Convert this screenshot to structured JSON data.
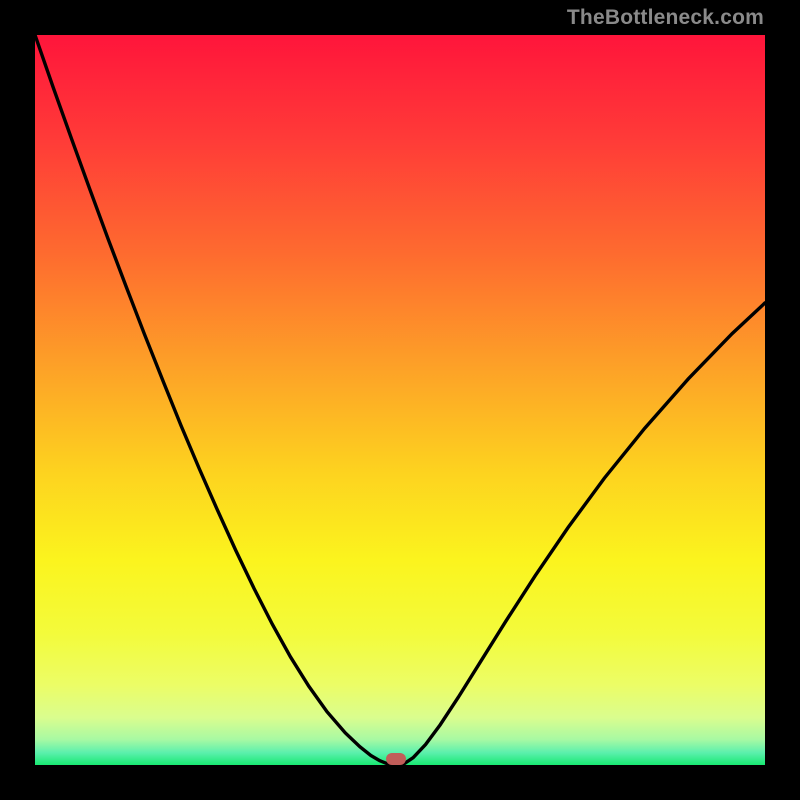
{
  "watermark": "TheBottleneck.com",
  "colors": {
    "marker": "#c15d59",
    "curve": "#000000",
    "frame": "#000000"
  },
  "chart_data": {
    "type": "line",
    "title": "",
    "xlabel": "",
    "ylabel": "",
    "xlim": [
      0,
      1
    ],
    "ylim": [
      0,
      1
    ],
    "x": [
      0.0,
      0.025,
      0.05,
      0.075,
      0.1,
      0.125,
      0.15,
      0.175,
      0.2,
      0.225,
      0.25,
      0.275,
      0.3,
      0.325,
      0.35,
      0.375,
      0.4,
      0.425,
      0.445,
      0.46,
      0.472,
      0.482,
      0.49,
      0.498,
      0.506,
      0.518,
      0.535,
      0.555,
      0.58,
      0.61,
      0.645,
      0.685,
      0.73,
      0.78,
      0.835,
      0.895,
      0.955,
      1.0
    ],
    "y": [
      1.0,
      0.928,
      0.858,
      0.789,
      0.721,
      0.655,
      0.59,
      0.527,
      0.465,
      0.406,
      0.349,
      0.294,
      0.242,
      0.193,
      0.148,
      0.108,
      0.073,
      0.044,
      0.025,
      0.013,
      0.006,
      0.002,
      0.0,
      0.0,
      0.002,
      0.01,
      0.028,
      0.055,
      0.093,
      0.141,
      0.197,
      0.259,
      0.325,
      0.393,
      0.461,
      0.529,
      0.591,
      0.633
    ],
    "min_point": {
      "x": 0.494,
      "y": 0.0
    },
    "annotations": []
  }
}
